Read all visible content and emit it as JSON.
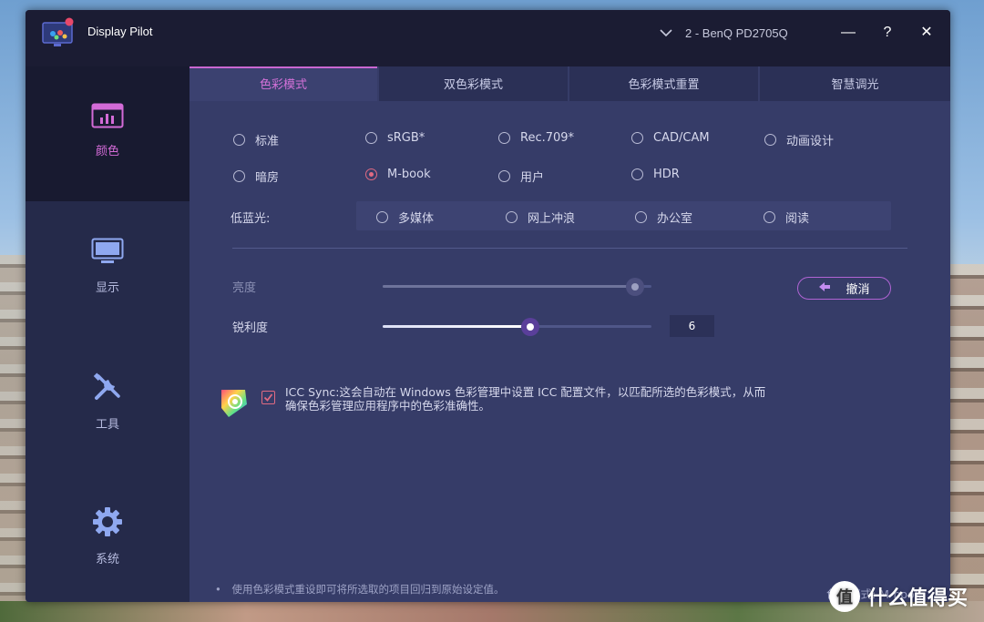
{
  "app": {
    "title": "Display Pilot",
    "monitor": "2 - BenQ PD2705Q",
    "minimize": "—",
    "help": "?",
    "close": "✕"
  },
  "sidebar": {
    "items": [
      {
        "label": "颜色",
        "icon": "color-icon",
        "active": true
      },
      {
        "label": "显示",
        "icon": "display-icon",
        "active": false
      },
      {
        "label": "工具",
        "icon": "tools-icon",
        "active": false
      },
      {
        "label": "系统",
        "icon": "gear-icon",
        "active": false
      }
    ]
  },
  "tabs": [
    {
      "label": "色彩模式",
      "active": true
    },
    {
      "label": "双色彩模式",
      "active": false
    },
    {
      "label": "色彩模式重置",
      "active": false
    },
    {
      "label": "智慧调光",
      "active": false
    }
  ],
  "color_modes": [
    {
      "label": "标准",
      "checked": false
    },
    {
      "label": "sRGB*",
      "checked": false
    },
    {
      "label": "Rec.709*",
      "checked": false
    },
    {
      "label": "CAD/CAM",
      "checked": false
    },
    {
      "label": "动画设计",
      "checked": false
    },
    {
      "label": "暗房",
      "checked": false
    },
    {
      "label": "M-book",
      "checked": true
    },
    {
      "label": "用户",
      "checked": false
    },
    {
      "label": "HDR",
      "checked": false
    }
  ],
  "low_blue_light": {
    "label": "低蓝光:",
    "options": [
      {
        "label": "多媒体",
        "checked": false
      },
      {
        "label": "网上冲浪",
        "checked": false
      },
      {
        "label": "办公室",
        "checked": false
      },
      {
        "label": "阅读",
        "checked": false
      }
    ]
  },
  "brightness": {
    "label": "亮度",
    "level": 0.94,
    "disabled": true
  },
  "sharpness": {
    "label": "锐利度",
    "value": "6",
    "level": 0.55
  },
  "undo_label": "撤消",
  "icc_sync": {
    "checked": true,
    "text": "ICC Sync:这会自动在 Windows 色彩管理中设置 ICC 配置文件，以匹配所选的色彩模式，从而确保色彩管理应用程序中的色彩准确性。"
  },
  "footer": {
    "note": "使用色彩模式重设即可将所选取的项目回归到原始设定值。",
    "bullet": "•",
    "status": "色彩模式: M-book"
  },
  "watermark": {
    "badge": "值",
    "text": "什么值得买"
  },
  "colors": {
    "accent": "#c967d1",
    "radio_checked": "#e06a82",
    "titlebar": "#1b1c33",
    "sidebar": "#252a4a",
    "content": "#363c68"
  }
}
